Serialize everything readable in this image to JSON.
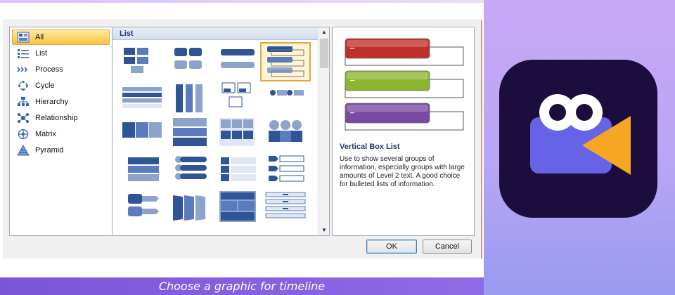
{
  "dialog": {
    "categories": [
      {
        "label": "All",
        "icon": "all-icon",
        "selected": true
      },
      {
        "label": "List",
        "icon": "list-icon",
        "selected": false
      },
      {
        "label": "Process",
        "icon": "process-icon",
        "selected": false
      },
      {
        "label": "Cycle",
        "icon": "cycle-icon",
        "selected": false
      },
      {
        "label": "Hierarchy",
        "icon": "hierarchy-icon",
        "selected": false
      },
      {
        "label": "Relationship",
        "icon": "relationship-icon",
        "selected": false
      },
      {
        "label": "Matrix",
        "icon": "matrix-icon",
        "selected": false
      },
      {
        "label": "Pyramid",
        "icon": "pyramid-icon",
        "selected": false
      }
    ],
    "gallery_title": "List",
    "selected_layout_index": 3,
    "preview": {
      "title": "Vertical Box List",
      "description": "Use to show several groups of information, especially groups with large amounts of Level 2 text. A good choice for bulleted lists of information.",
      "box_colors": [
        "#c0302a",
        "#8db52f",
        "#7a4aa2"
      ]
    },
    "ok_label": "OK",
    "cancel_label": "Cancel"
  },
  "caption": "Choose a graphic for timeline",
  "colors": {
    "smartart_blue": "#2f5597",
    "smartart_light": "#8da3cc",
    "selection_orange": "#e0a845",
    "caption_bar": "#7a55d8",
    "logo_bg": "#1b0d3d",
    "logo_body": "#6563e6",
    "logo_lens": "#f5a623"
  }
}
